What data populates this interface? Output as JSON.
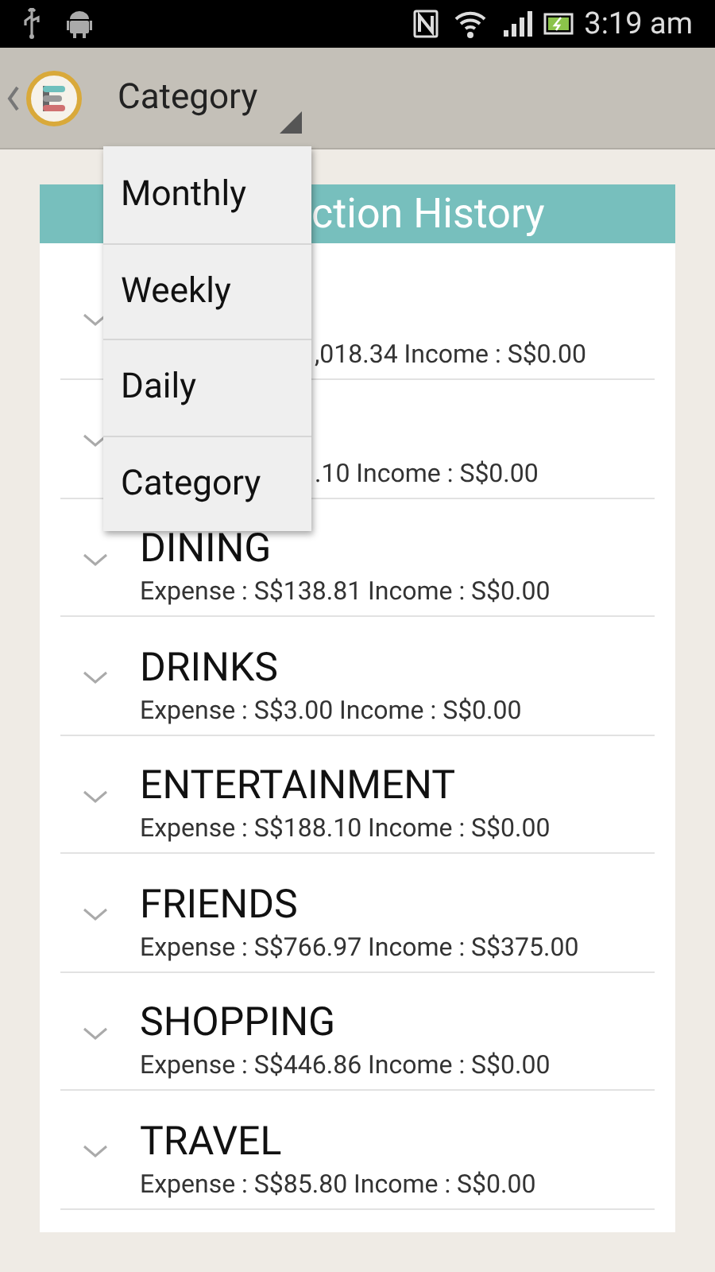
{
  "status_bar": {
    "time": "3:19 am"
  },
  "action_bar": {
    "spinner_value": "Category"
  },
  "dropdown": {
    "items": [
      {
        "label": "Monthly"
      },
      {
        "label": "Weekly"
      },
      {
        "label": "Daily"
      },
      {
        "label": "Category"
      }
    ]
  },
  "card": {
    "title": "ction History",
    "rows": [
      {
        "summary": ",018.34 Income : S$0.00"
      },
      {
        "summary": ".10 Income : S$0.00"
      },
      {
        "name": "DINING",
        "summary": "Expense : S$138.81 Income : S$0.00"
      },
      {
        "name": "DRINKS",
        "summary": "Expense : S$3.00 Income : S$0.00"
      },
      {
        "name": "ENTERTAINMENT",
        "summary": "Expense : S$188.10 Income : S$0.00"
      },
      {
        "name": "FRIENDS",
        "summary": "Expense : S$766.97 Income : S$375.00"
      },
      {
        "name": "SHOPPING",
        "summary": "Expense : S$446.86 Income : S$0.00"
      },
      {
        "name": "TRAVEL",
        "summary": "Expense : S$85.80 Income : S$0.00"
      }
    ]
  }
}
